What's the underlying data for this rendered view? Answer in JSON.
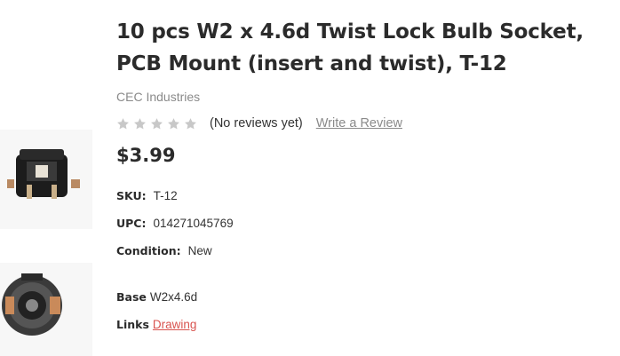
{
  "product": {
    "title": "10 pcs W2 x 4.6d Twist Lock Bulb Socket, PCB Mount (insert and twist), T-12",
    "brand": "CEC Industries",
    "reviews_text": "(No reviews yet)",
    "write_review_label": "Write a Review",
    "rating": 0,
    "rating_max": 5,
    "price": "$3.99"
  },
  "specs": {
    "sku_label": "SKU:",
    "sku_value": "T-12",
    "upc_label": "UPC:",
    "upc_value": "014271045769",
    "condition_label": "Condition:",
    "condition_value": "New",
    "base_label": "Base",
    "base_value": "W2x4.6d",
    "links_label": "Links",
    "links_value": "Drawing"
  },
  "colors": {
    "star_empty": "#c8c8c8",
    "link_red": "#d9534f",
    "muted": "#8a8a8a"
  },
  "thumbnails": [
    {
      "icon": "bulb-socket-side-image"
    },
    {
      "icon": "bulb-socket-top-image"
    }
  ]
}
